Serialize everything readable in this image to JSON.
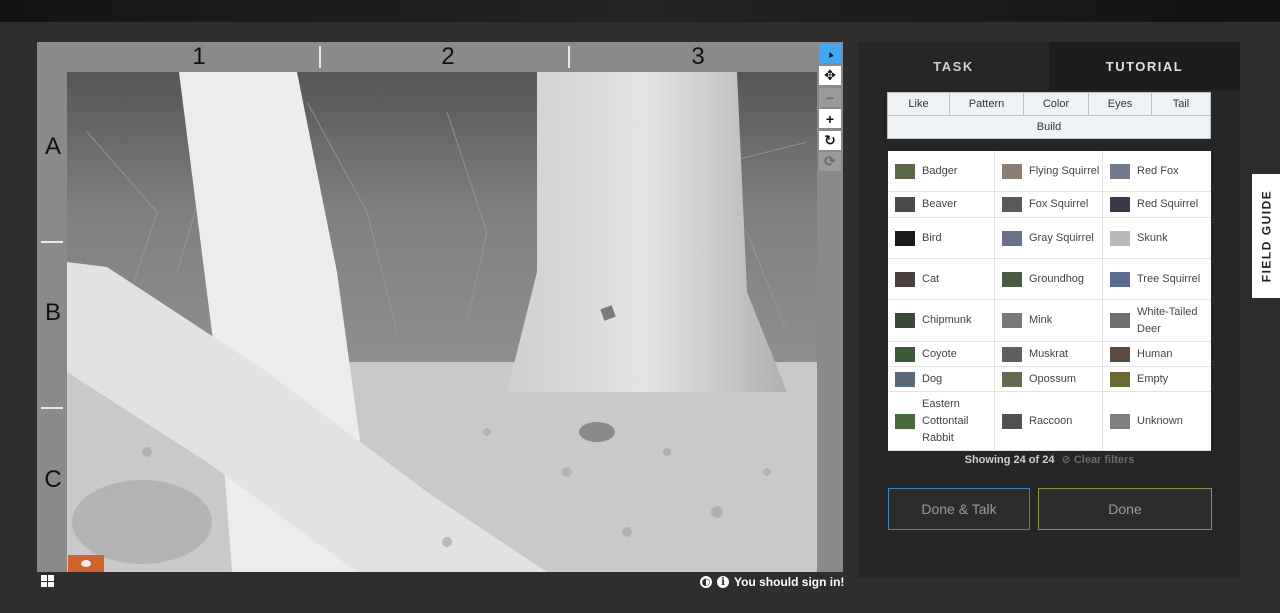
{
  "viewer": {
    "columns": [
      "1",
      "2",
      "3"
    ],
    "rows": [
      "A",
      "B",
      "C"
    ],
    "tools": [
      {
        "name": "pointer-tool",
        "glyph": "▲"
      },
      {
        "name": "move-tool",
        "glyph": "✥"
      },
      {
        "name": "zoom-out-tool",
        "glyph": "−"
      },
      {
        "name": "zoom-in-tool",
        "glyph": "+"
      },
      {
        "name": "rotate-tool",
        "glyph": "↻"
      },
      {
        "name": "reset-tool",
        "glyph": "⟳"
      }
    ],
    "footer": {
      "contrast_icon": "◐",
      "info_icon": "i",
      "sign_in_text": "You should sign in!"
    }
  },
  "panel": {
    "tabs": [
      "TASK",
      "TUTORIAL"
    ],
    "filters_row1": [
      "Like",
      "Pattern",
      "Color",
      "Eyes",
      "Tail"
    ],
    "filters_row2": [
      "Build"
    ],
    "species": [
      {
        "name": "Badger",
        "thumb": "#5a6a45"
      },
      {
        "name": "Flying Squirrel",
        "thumb": "#8a8070"
      },
      {
        "name": "Red Fox",
        "thumb": "#707a88"
      },
      {
        "name": "Beaver",
        "thumb": "#4a4a4a"
      },
      {
        "name": "Fox Squirrel",
        "thumb": "#5a5a5a"
      },
      {
        "name": "Red Squirrel",
        "thumb": "#3a3a4a"
      },
      {
        "name": "Bird",
        "thumb": "#1a1a1a"
      },
      {
        "name": "Gray Squirrel",
        "thumb": "#6a7088"
      },
      {
        "name": "Skunk",
        "thumb": "#b8b8b8"
      },
      {
        "name": "Cat",
        "thumb": "#4a4040"
      },
      {
        "name": "Groundhog",
        "thumb": "#4a5a40"
      },
      {
        "name": "Tree Squirrel",
        "thumb": "#5a6a90"
      },
      {
        "name": "Chipmunk",
        "thumb": "#3a4a3a"
      },
      {
        "name": "Mink",
        "thumb": "#7a7a7a"
      },
      {
        "name": "White-Tailed Deer",
        "thumb": "#707070"
      },
      {
        "name": "Coyote",
        "thumb": "#3a5a3a"
      },
      {
        "name": "Muskrat",
        "thumb": "#606060"
      },
      {
        "name": "Human",
        "thumb": "#5a4a40"
      },
      {
        "name": "Dog",
        "thumb": "#5a6a7a"
      },
      {
        "name": "Opossum",
        "thumb": "#6a6a50"
      },
      {
        "name": "Empty",
        "thumb": "#6a6a30"
      },
      {
        "name": "Eastern Cottontail Rabbit",
        "thumb": "#4a6a3a"
      },
      {
        "name": "Raccoon",
        "thumb": "#505050"
      },
      {
        "name": "Unknown",
        "thumb": "#808080"
      }
    ],
    "showing_text": "Showing 24 of 24",
    "clear_filters": "⊘ Clear filters",
    "done_talk_label": "Done & Talk",
    "done_label": "Done"
  },
  "field_guide_label": "FIELD GUIDE",
  "colors": {
    "accent_blue": "#3fa9f5",
    "talk_border": "#3f86b8",
    "done_border": "#8a9a3a",
    "flag_orange": "#d0622a"
  }
}
